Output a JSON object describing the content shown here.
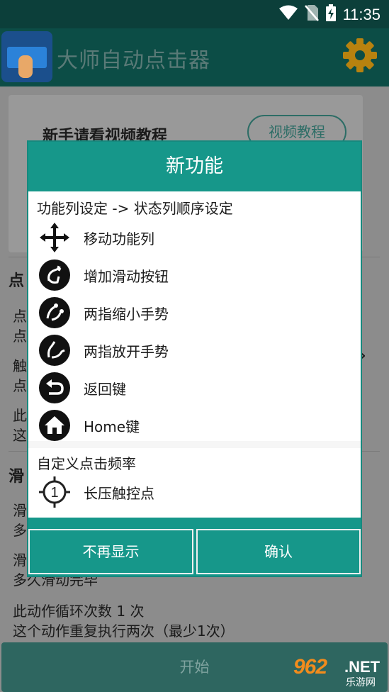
{
  "status_bar": {
    "time": "11:35",
    "icons": [
      "wifi-icon",
      "no-sim-icon",
      "battery-charging-icon"
    ]
  },
  "app_bar": {
    "title": "大师自动点击器",
    "settings_icon": "gear-icon",
    "accent": "#d99214"
  },
  "background": {
    "tutorial_label": "新手请看视频教程",
    "tutorial_button": "视频教程",
    "line1": "点",
    "line2": "点",
    "line3": "点",
    "line4": "触",
    "line5": "点",
    "line6": "此",
    "line7": "这",
    "line8": "滑",
    "line9": "滑",
    "line10": "多",
    "line11": "滑",
    "partial_line": "多久滑动完毕",
    "loop_count_label": "此动作循环次数   1  次",
    "loop_desc": "这个动作重复执行两次（最少1次）",
    "start_button": "开始"
  },
  "dialog": {
    "title": "新功能",
    "section1": "功能列设定 -> 状态列顺序设定",
    "items": [
      {
        "icon": "move-arrows-icon",
        "label": "移动功能列"
      },
      {
        "icon": "swipe-gesture-icon",
        "label": "增加滑动按钮"
      },
      {
        "icon": "pinch-in-icon",
        "label": "两指缩小手势"
      },
      {
        "icon": "pinch-out-icon",
        "label": "两指放开手势"
      },
      {
        "icon": "back-arrow-icon",
        "label": "返回键"
      },
      {
        "icon": "home-icon",
        "label": "Home键"
      }
    ],
    "section2": "自定义点击频率",
    "long_press": {
      "icon": "crosshair-target-icon",
      "label": "长压触控点",
      "number": "1"
    },
    "buttons": {
      "dismiss": "不再显示",
      "confirm": "确认"
    },
    "accent": "#16978a"
  },
  "watermark": {
    "main": "962",
    "net": ".NET",
    "sub": "乐游网"
  }
}
